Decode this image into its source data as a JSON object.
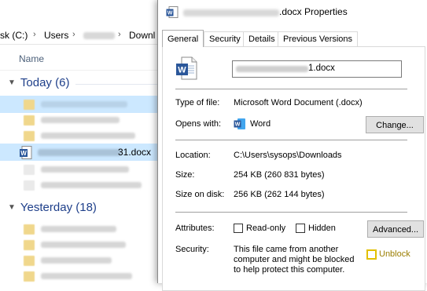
{
  "explorer": {
    "breadcrumb": [
      "sk (C:)",
      "Users",
      "Downl"
    ],
    "column_header": "Name",
    "groups": [
      {
        "label": "Today (6)"
      },
      {
        "label": "Yesterday (18)"
      }
    ],
    "selected_file_suffix": "31.docx"
  },
  "dialog": {
    "title_suffix": ".docx Properties",
    "tabs": [
      "General",
      "Security",
      "Details",
      "Previous Versions"
    ],
    "active_tab": "General",
    "filename_suffix": "1.docx",
    "type_of_file_label": "Type of file:",
    "type_of_file_value": "Microsoft Word Document (.docx)",
    "opens_with_label": "Opens with:",
    "opens_with_value": "Word",
    "change_button": "Change...",
    "location_label": "Location:",
    "location_value": "C:\\Users\\sysops\\Downloads",
    "size_label": "Size:",
    "size_value": "254 KB (260 831 bytes)",
    "size_on_disk_label": "Size on disk:",
    "size_on_disk_value": "256 KB (262 144 bytes)",
    "attributes_label": "Attributes:",
    "readonly_label": "Read-only",
    "hidden_label": "Hidden",
    "advanced_button": "Advanced...",
    "security_label": "Security:",
    "security_text": "This file came from another computer and might be blocked to help protect this computer.",
    "unblock_label": "Unblock",
    "accent_color": "#1e3f8a",
    "word_blue": "#2b579a",
    "unblock_highlight": "#e2c000"
  }
}
